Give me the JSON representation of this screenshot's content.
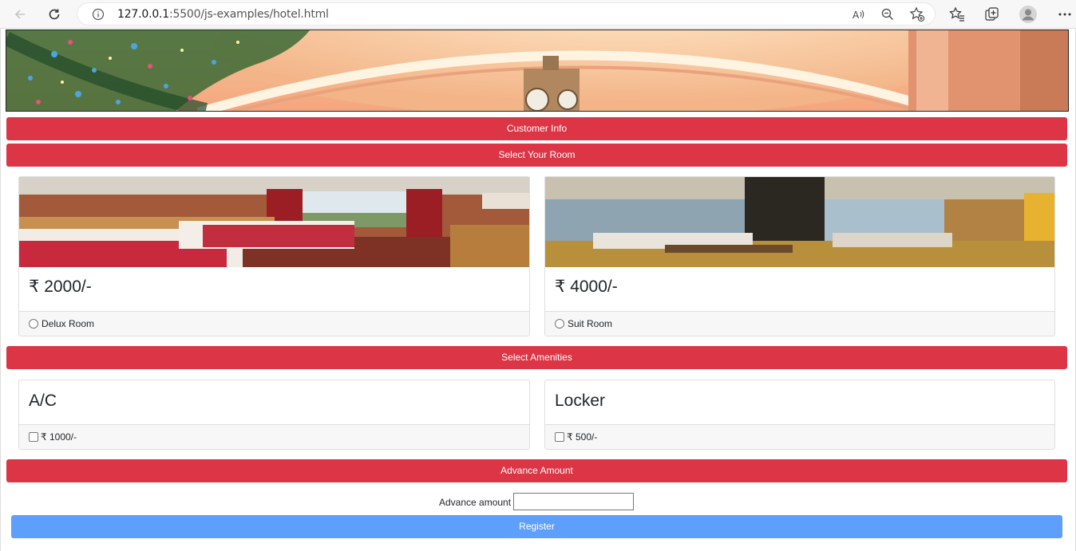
{
  "browser": {
    "url_host": "127.0.0.1",
    "url_path": ":5500/js-examples/hotel.html"
  },
  "sections": {
    "customer_info": "Customer Info",
    "select_room": "Select Your Room",
    "select_amenities": "Select Amenities",
    "advance_amount": "Advance Amount"
  },
  "rooms": [
    {
      "price": "₹ 2000/-",
      "label": "Delux Room"
    },
    {
      "price": "₹ 4000/-",
      "label": "Suit Room"
    }
  ],
  "amenities": [
    {
      "title": "A/C",
      "price": "₹ 1000/-"
    },
    {
      "title": "Locker",
      "price": "₹ 500/-"
    }
  ],
  "advance": {
    "label": "Advance amount",
    "value": ""
  },
  "register_label": "Register",
  "colors": {
    "section_bar": "#dc3545",
    "register_button": "#5e9ffc"
  }
}
